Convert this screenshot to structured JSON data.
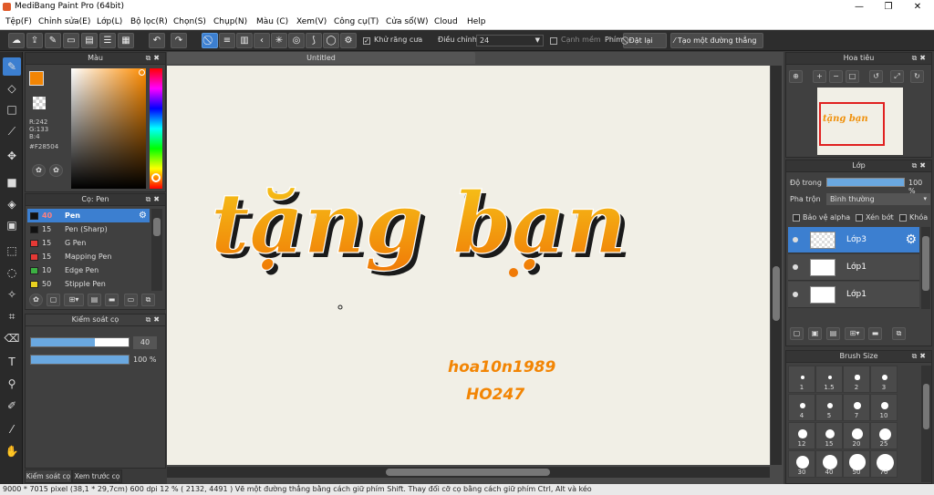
{
  "window": {
    "title": "MediBang Paint Pro (64bit)",
    "minimize": "—",
    "maximize": "❐",
    "close": "✕"
  },
  "menu": [
    "Tệp(F)",
    "Chỉnh sửa(E)",
    "Lớp(L)",
    "Bộ lọc(R)",
    "Chọn(S)",
    "Chụp(N)",
    "Màu (C)",
    "Xem(V)",
    "Công cụ(T)",
    "Cửa sổ(W)",
    "Cloud",
    "Help"
  ],
  "toolbar": {
    "antialias_label": "Khử răng cưa",
    "adjust_label": "Điều chỉnh",
    "adjust_value": "24",
    "edge_label": "Cạnh mềm",
    "key_label": "Phím",
    "reset_label": "Đặt lại",
    "straight_line_label": "Tạo một đường thẳng"
  },
  "color_panel": {
    "title": "Màu",
    "primary_color": "#F28504",
    "r": "R:242",
    "g": "G:133",
    "b": "B:4",
    "hex": "#F28504"
  },
  "brush_panel": {
    "title": "Cọ: Pen",
    "items": [
      {
        "size": "40",
        "name": "Pen",
        "color": "#111111",
        "selected": true
      },
      {
        "size": "15",
        "name": "Pen (Sharp)",
        "color": "#111111"
      },
      {
        "size": "15",
        "name": "G Pen",
        "color": "#e53935"
      },
      {
        "size": "15",
        "name": "Mapping Pen",
        "color": "#e53935"
      },
      {
        "size": "10",
        "name": "Edge Pen",
        "color": "#3cb043"
      },
      {
        "size": "50",
        "name": "Stipple Pen",
        "color": "#e8d020"
      }
    ]
  },
  "brush_control": {
    "title": "Kiểm soát cọ",
    "size_value": "40",
    "size_fraction": 0.65,
    "opacity_value": "100 %",
    "opacity_fraction": 1.0
  },
  "bottom_tabs": {
    "tab1": "Kiểm soát cọ",
    "tab2": "Xem trước cọ"
  },
  "document": {
    "tab": "Untitled"
  },
  "artwork": {
    "main_text": "tặng bạn",
    "sub1": "hoa10n1989",
    "sub2": "HO247",
    "ink_color": "#F28504"
  },
  "navigator": {
    "title": "Hoa tiêu"
  },
  "layer_panel": {
    "title": "Lớp",
    "opacity_label": "Độ trong",
    "opacity_value": "100 %",
    "blend_label": "Pha trộn",
    "blend_value": "Bình thường",
    "protect_alpha": "Bảo vệ alpha",
    "clip": "Xén bớt",
    "lock": "Khóa",
    "layers": [
      {
        "name": "Lớp3",
        "selected": true
      },
      {
        "name": "Lớp1"
      },
      {
        "name": "Lớp1"
      }
    ]
  },
  "brush_size_panel": {
    "title": "Brush Size",
    "sizes": [
      "1",
      "1.5",
      "2",
      "3",
      "4",
      "5",
      "7",
      "10",
      "12",
      "15",
      "20",
      "25",
      "30",
      "40",
      "50",
      "70"
    ]
  },
  "status": {
    "text": "9000 * 7015 pixel   (38,1 * 29,7cm)   600 dpi   12 %   ( 2132, 4491 )   Vẽ một đường thẳng bằng cách giữ phím Shift. Thay đổi cỡ cọ bằng cách giữ phím Ctrl, Alt và kéo"
  }
}
